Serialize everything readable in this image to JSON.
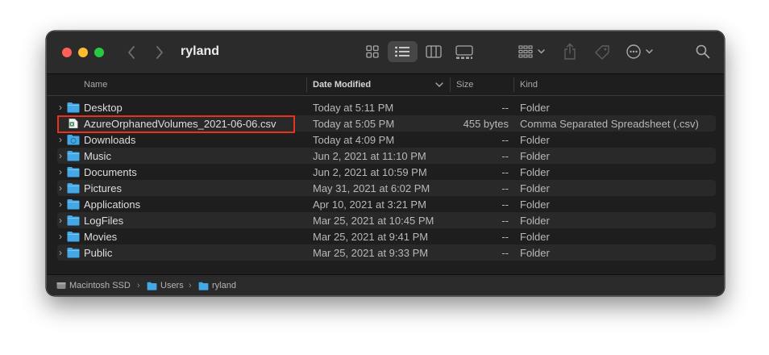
{
  "window": {
    "title": "ryland"
  },
  "toolbar": {
    "back_icon": "chevron-left-icon",
    "forward_icon": "chevron-right-icon",
    "views": [
      "icon-view-icon",
      "list-view-icon",
      "column-view-icon",
      "gallery-view-icon"
    ],
    "active_view": "list-view-icon",
    "group_icon": "group-by-icon",
    "share_icon": "share-icon",
    "tag_icon": "tag-icon",
    "action_icon": "more-actions-icon",
    "search_icon": "search-icon"
  },
  "columns": {
    "name": "Name",
    "date_modified": "Date Modified",
    "size": "Size",
    "kind": "Kind"
  },
  "rows": [
    {
      "name": "Desktop",
      "date": "Today at 5:11 PM",
      "size": "--",
      "kind": "Folder",
      "type": "folder"
    },
    {
      "name": "AzureOrphanedVolumes_2021-06-06.csv",
      "date": "Today at 5:05 PM",
      "size": "455 bytes",
      "kind": "Comma Separated Spreadsheet (.csv)",
      "type": "csv"
    },
    {
      "name": "Downloads",
      "date": "Today at 4:09 PM",
      "size": "--",
      "kind": "Folder",
      "type": "folder"
    },
    {
      "name": "Music",
      "date": "Jun 2, 2021 at 11:10 PM",
      "size": "--",
      "kind": "Folder",
      "type": "folder"
    },
    {
      "name": "Documents",
      "date": "Jun 2, 2021 at 10:59 PM",
      "size": "--",
      "kind": "Folder",
      "type": "folder"
    },
    {
      "name": "Pictures",
      "date": "May 31, 2021 at 6:02 PM",
      "size": "--",
      "kind": "Folder",
      "type": "folder"
    },
    {
      "name": "Applications",
      "date": "Apr 10, 2021 at 3:21 PM",
      "size": "--",
      "kind": "Folder",
      "type": "folder"
    },
    {
      "name": "LogFiles",
      "date": "Mar 25, 2021 at 10:45 PM",
      "size": "--",
      "kind": "Folder",
      "type": "folder"
    },
    {
      "name": "Movies",
      "date": "Mar 25, 2021 at 9:41 PM",
      "size": "--",
      "kind": "Folder",
      "type": "folder"
    },
    {
      "name": "Public",
      "date": "Mar 25, 2021 at 9:33 PM",
      "size": "--",
      "kind": "Folder",
      "type": "folder"
    }
  ],
  "pathbar": {
    "items": [
      "Macintosh SSD",
      "Users",
      "ryland"
    ]
  },
  "colors": {
    "folder": "#45a8e6",
    "highlight": "#e8321e",
    "csv": "#1f7a3e"
  }
}
